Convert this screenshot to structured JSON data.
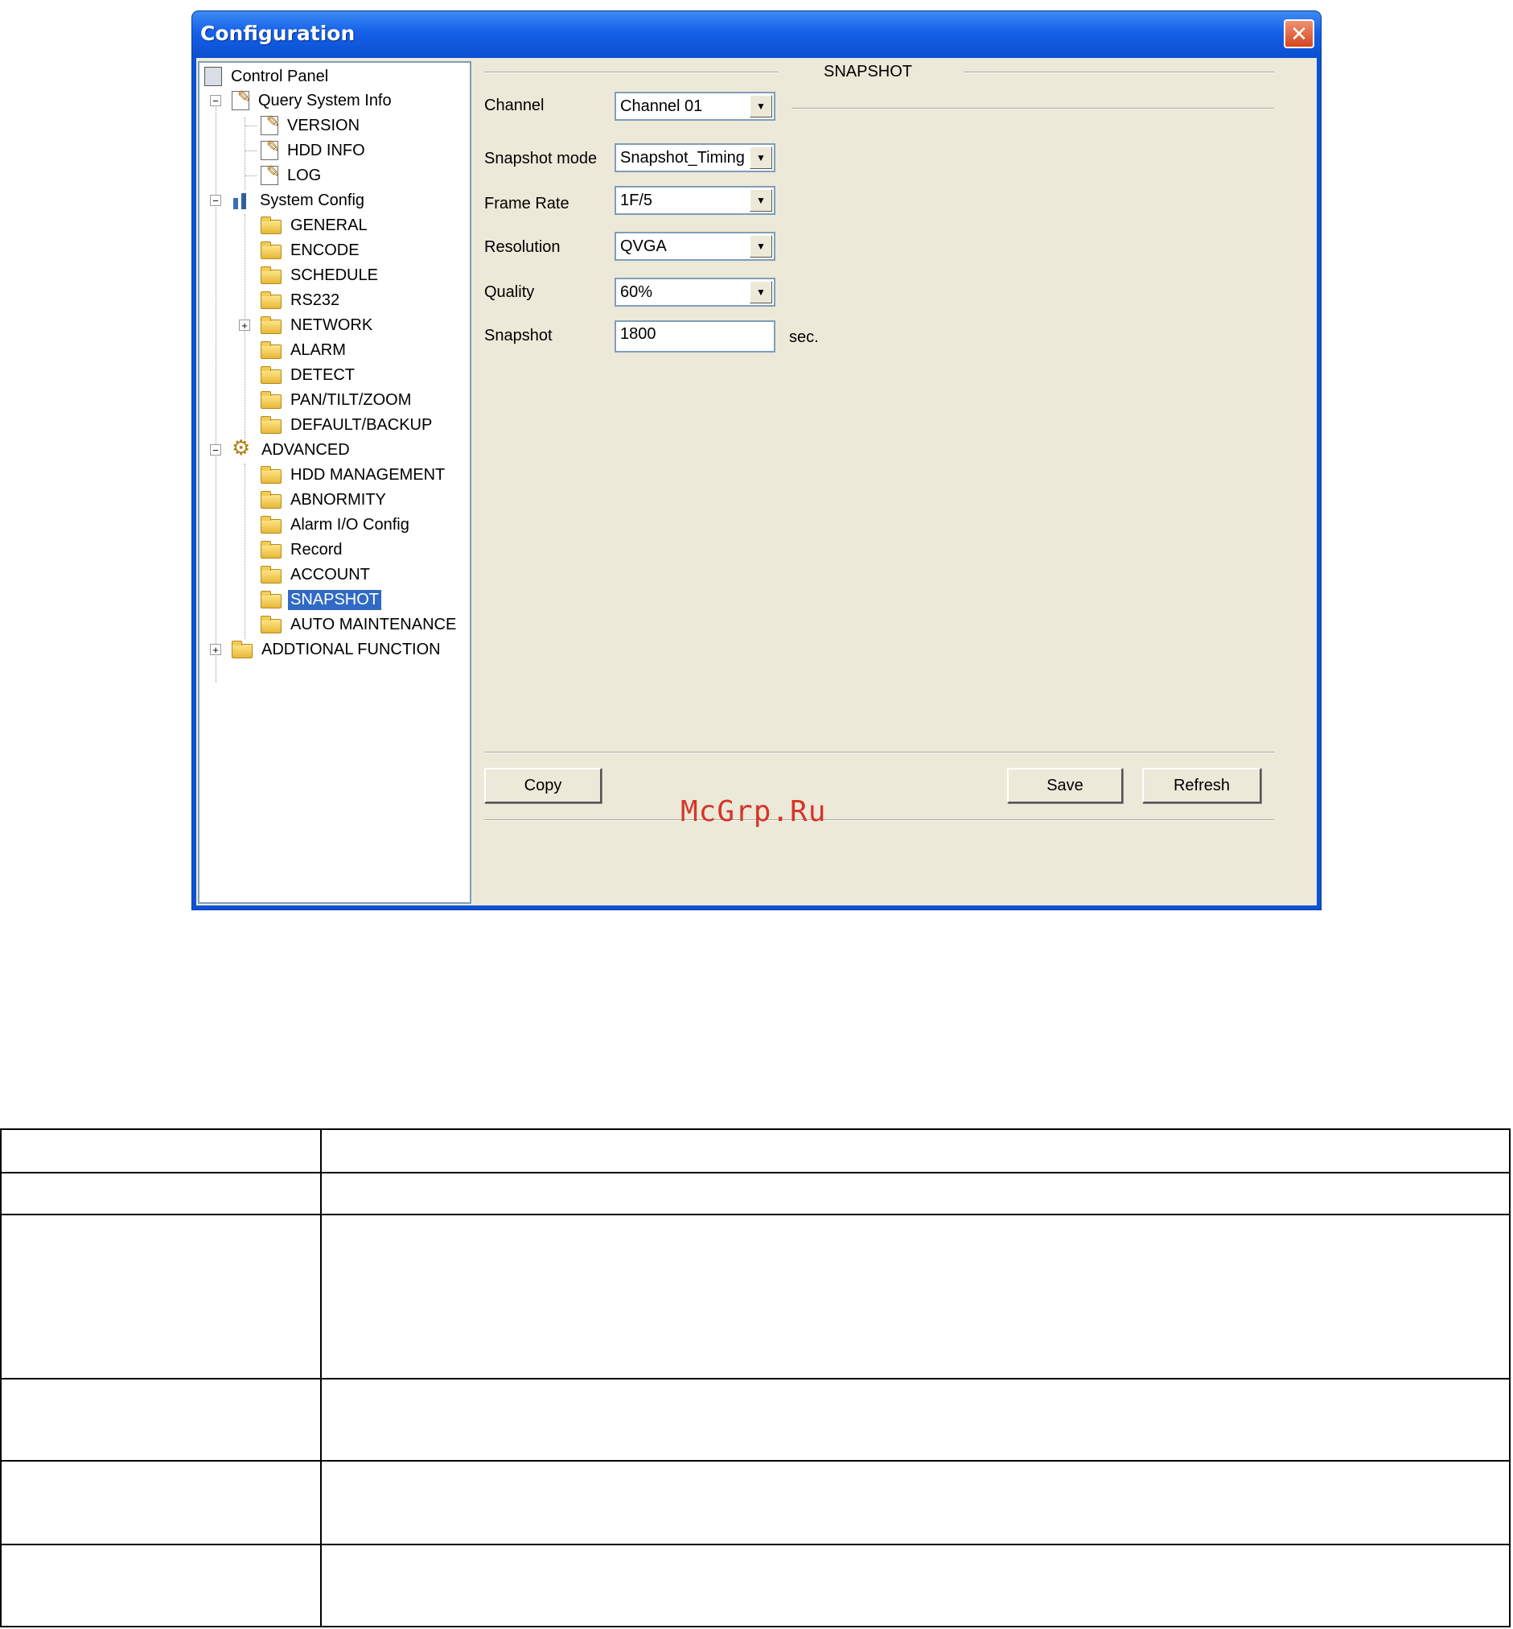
{
  "window": {
    "title": "Configuration"
  },
  "tree": {
    "root": "Control Panel",
    "query_system_info": {
      "label": "Query System Info",
      "children": [
        "VERSION",
        "HDD INFO",
        "LOG"
      ]
    },
    "system_config": {
      "label": "System Config",
      "children": [
        "GENERAL",
        "ENCODE",
        "SCHEDULE",
        "RS232",
        "NETWORK",
        "ALARM",
        "DETECT",
        "PAN/TILT/ZOOM",
        "DEFAULT/BACKUP"
      ]
    },
    "advanced": {
      "label": "ADVANCED",
      "children": [
        "HDD MANAGEMENT",
        "ABNORMITY",
        "Alarm I/O Config",
        "Record",
        "ACCOUNT",
        "SNAPSHOT",
        "AUTO MAINTENANCE"
      ]
    },
    "additional_function": {
      "label": "ADDTIONAL FUNCTION"
    },
    "selected": "SNAPSHOT"
  },
  "snapshot": {
    "section_title": "SNAPSHOT",
    "channel": {
      "label": "Channel",
      "value": "Channel 01"
    },
    "mode": {
      "label": "Snapshot mode",
      "value": "Snapshot_Timing"
    },
    "frame_rate": {
      "label": "Frame Rate",
      "value": "1F/5"
    },
    "resolution": {
      "label": "Resolution",
      "value": "QVGA"
    },
    "quality": {
      "label": "Quality",
      "value": "60%"
    },
    "interval": {
      "label": "Snapshot",
      "value": "1800",
      "unit": "sec."
    }
  },
  "buttons": {
    "copy": "Copy",
    "save": "Save",
    "refresh": "Refresh"
  },
  "watermark": "McGrp.Ru",
  "table": {
    "rows": 6,
    "columns": 2
  }
}
